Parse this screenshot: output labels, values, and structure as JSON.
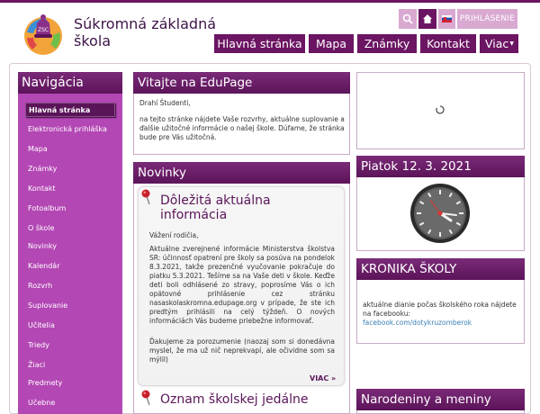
{
  "header": {
    "school_name_line1": "Súkromná základná",
    "school_name_line2": "škola",
    "login_label": "PRIHLÁSENIE",
    "nav": [
      "Hlavná stránka",
      "Mapa",
      "Známky",
      "Kontakt",
      "Viac"
    ],
    "accent_color": "#6b1563"
  },
  "sidebar": {
    "title": "Navigácia",
    "items": [
      "Hlavná stránka",
      "Elektronická prihláška",
      "Mapa",
      "Známky",
      "Kontakt",
      "Fotoalbum",
      "O škole",
      "Novinky",
      "Kalendár",
      "Rozvrh",
      "Suplovanie",
      "Učitelia",
      "Triedy",
      "Žiaci",
      "Predmety",
      "Učebne"
    ]
  },
  "welcome": {
    "title": "Vitajte na EduPage",
    "greeting": "Drahí Študenti,",
    "body": "na tejto stránke nájdete Vaše rozvrhy, aktuálne suplovanie a ďalšie užitočné informácie o našej škole. Dúfame, že stránka bude pre Vás užitočná."
  },
  "news": {
    "title": "Novinky",
    "item1": {
      "title_line1": "Dôležitá aktuálna",
      "title_line2": "informácia",
      "salutation": "Vážení rodičia,",
      "para1": "Aktuálne zverejnené informácie Ministerstva školstva SR: účinnosť opatrení pre školy sa posúva na pondelok 8.3.2021, takže prezenčné vyučovanie pokračuje do piatku 5.3.2021. Tešíme sa na Vaše deti v škole. Keďže deti boli odhlásené zo stravy, poprosíme Vás o ich opätovné prihlásenie cez stránku nasaskolaskromna.edupage.org v prípade, že ste ich predtým prihlásili na celý týždeň. O nových informáciách Vás budeme priebežne informovať.",
      "para2": "Ďakujeme za porozumenie (naozaj som si donedávna myslel, že ma už nič neprekvapí, ale očividne som sa mýlil)",
      "more": "VIAC »"
    },
    "item2": {
      "title": "Oznam školskej jedálne"
    }
  },
  "date_panel": {
    "title": "Piatok 12. 3. 2021"
  },
  "chronicle": {
    "title": "KRONIKA ŠKOLY",
    "text": "aktuálne dianie počas školského roka nájdete na facebooku:",
    "link": "facebook.com/dotykruzomberok"
  },
  "birthdays": {
    "title": "Narodeniny a meniny"
  }
}
